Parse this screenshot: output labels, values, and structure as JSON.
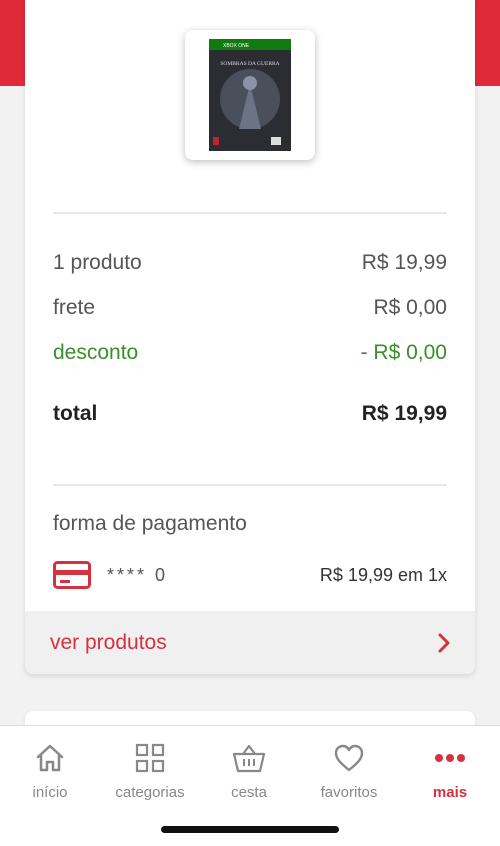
{
  "product": {
    "image_label": "SOMBRAS DA GUERRA",
    "platform_label": "XBOX ONE"
  },
  "summary": {
    "products_label": "1 produto",
    "products_value": "R$ 19,99",
    "shipping_label": "frete",
    "shipping_value": "R$ 0,00",
    "discount_label": "desconto",
    "discount_value": "- R$ 0,00",
    "total_label": "total",
    "total_value": "R$ 19,99"
  },
  "payment": {
    "title": "forma de pagamento",
    "card_mask": "****",
    "card_last": "0",
    "amount": "R$ 19,99 em 1x",
    "icon": "credit-card-icon"
  },
  "view_products": {
    "label": "ver produtos",
    "icon": "chevron-right-icon"
  },
  "tabs": [
    {
      "label": "início",
      "icon": "home-icon",
      "active": false
    },
    {
      "label": "categorias",
      "icon": "grid-icon",
      "active": false
    },
    {
      "label": "cesta",
      "icon": "basket-icon",
      "active": false
    },
    {
      "label": "favoritos",
      "icon": "heart-icon",
      "active": false
    },
    {
      "label": "mais",
      "icon": "more-dots-icon",
      "active": true
    }
  ],
  "colors": {
    "brand_red": "#e02a3a",
    "accent_red": "#d4323f",
    "discount_green": "#3a8f2a"
  }
}
